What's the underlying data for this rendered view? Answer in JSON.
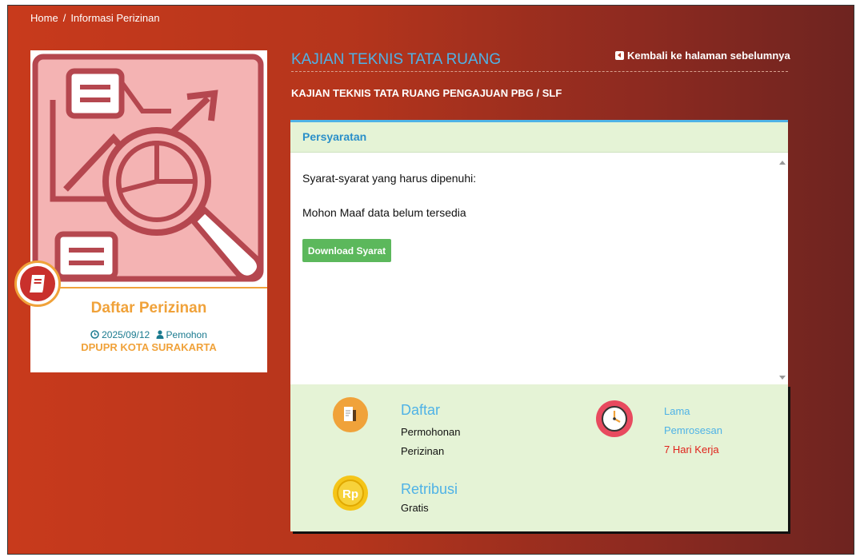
{
  "breadcrumb": {
    "home": "Home",
    "separator": "/",
    "current": "Informasi Perizinan"
  },
  "card": {
    "title": "Daftar Perizinan",
    "date": "2025/09/12",
    "role": "Pemohon",
    "org": "DPUPR KOTA SURAKARTA"
  },
  "header": {
    "title": "KAJIAN TEKNIS TATA RUANG",
    "back_label": "Kembali ke halaman sebelumnya",
    "subtitle": "KAJIAN TEKNIS TATA RUANG PENGAJUAN PBG / SLF"
  },
  "requirements": {
    "heading": "Persyaratan",
    "intro": "Syarat-syarat yang harus dipenuhi:",
    "empty": "Mohon Maaf data belum tersedia",
    "download_label": "Download Syarat"
  },
  "info": {
    "daftar": {
      "title": "Daftar",
      "line1": "Permohonan",
      "line2": "Perizinan"
    },
    "lama": {
      "line1": "Lama",
      "line2": "Pemrosesan",
      "value": "7 Hari Kerja"
    },
    "retribusi": {
      "title": "Retribusi",
      "value": "Gratis"
    }
  },
  "colors": {
    "accent_blue": "#4fb2e6",
    "accent_orange": "#f0a23a",
    "success_green": "#5cb85c",
    "danger_red": "#e0221b"
  },
  "icons": {
    "card_image": "magnifier-chart-illustration",
    "badge": "book-icon",
    "date": "clock-icon",
    "role": "user-icon",
    "back": "arrow-left-square-icon",
    "daftar": "document-icon",
    "lama": "clock-icon",
    "retribusi": "rupiah-coin-icon"
  }
}
